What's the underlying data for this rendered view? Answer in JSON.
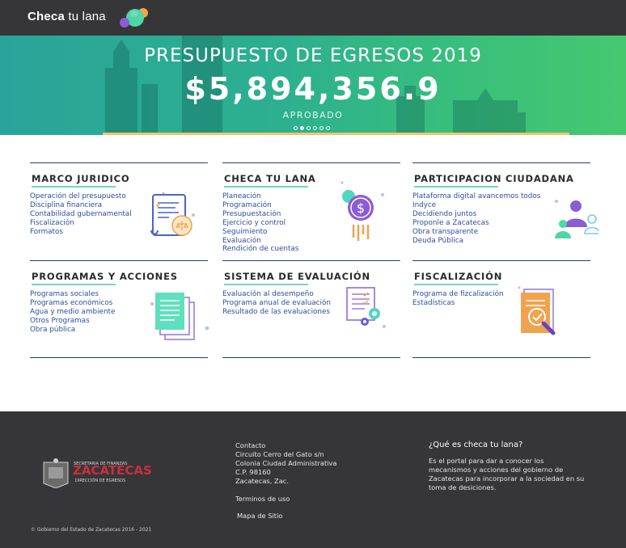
{
  "header": {
    "brand_bold": "Checa",
    "brand_rest": " tu lana",
    "logo_icon": "color-blob-logo"
  },
  "hero": {
    "title": "PRESUPUESTO DE EGRESOS 2019",
    "amount": "$5,894,356.9",
    "subtitle": "APROBADO",
    "slides": 6,
    "active_slide": 2
  },
  "sections": [
    {
      "title": "MARCO JURIDICO",
      "icon": "legal-document-icon",
      "links": [
        "Operación del presupuesto",
        "Disciplina financiera",
        "Contabilidad gubernamental",
        "Fiscalización",
        "Formatos"
      ]
    },
    {
      "title": "CHECA TU LANA",
      "icon": "money-coin-icon",
      "links": [
        "Planeación",
        "Programación",
        "Presupuestación",
        "Ejercicio y control",
        "Seguimiento",
        "Evaluación",
        "Rendición de cuentas"
      ]
    },
    {
      "title": "PARTICIPACION CIUDADANA",
      "icon": "people-group-icon",
      "links": [
        "Plataforma digital avancemos todos",
        "Indyce",
        "Decidiendo juntos",
        "Proponle a Zacatecas",
        "Obra transparente",
        "Deuda Pública"
      ]
    },
    {
      "title": "PROGRAMAS Y ACCIONES",
      "icon": "documents-stack-icon",
      "links": [
        "Programas sociales",
        "Programas económicos",
        "Agua y medio ambiente",
        "Otros Programas",
        "Obra pública"
      ]
    },
    {
      "title": "SISTEMA DE EVALUACIÓN",
      "icon": "checklist-gears-icon",
      "links": [
        "Evaluación al desempeño",
        "Programa anual de evaluación",
        "Resultado de las evaluaciones"
      ]
    },
    {
      "title": "FISCALIZACIÓN",
      "icon": "clipboard-magnifier-icon",
      "links": [
        "Programa de fizcalización",
        "Estadísticas"
      ]
    }
  ],
  "footer": {
    "logo": {
      "line1": "SECRETARIA DE FINANZAS",
      "line2": "ZACATECAS",
      "line3": "DIRECCIÓN DE EGRESOS"
    },
    "contact_title": "Contacto",
    "address": [
      "Circuito Cerro del Gato s/n",
      "Colonia Ciudad Administrativa",
      "C.P. 98160",
      "Zacatecas, Zac."
    ],
    "terms": "Terminos de uso",
    "sitemap": "Mapa de Sitio",
    "about_title": "¿Qué es checa tu lana?",
    "about_lines": [
      "Es el portal para dar a conocer los",
      "mecanismos y acciones del gobierno de",
      "Zacatecas para incorporar a la sociedad en su",
      "toma de desiciones."
    ],
    "copyright": "© Gobierno del Estado de Zacatecas 2016 - 2021"
  },
  "colors": {
    "topbar": "#363638",
    "link": "#2c4e9a",
    "accent_teal": "#73d6b8",
    "rule": "#22406b"
  }
}
